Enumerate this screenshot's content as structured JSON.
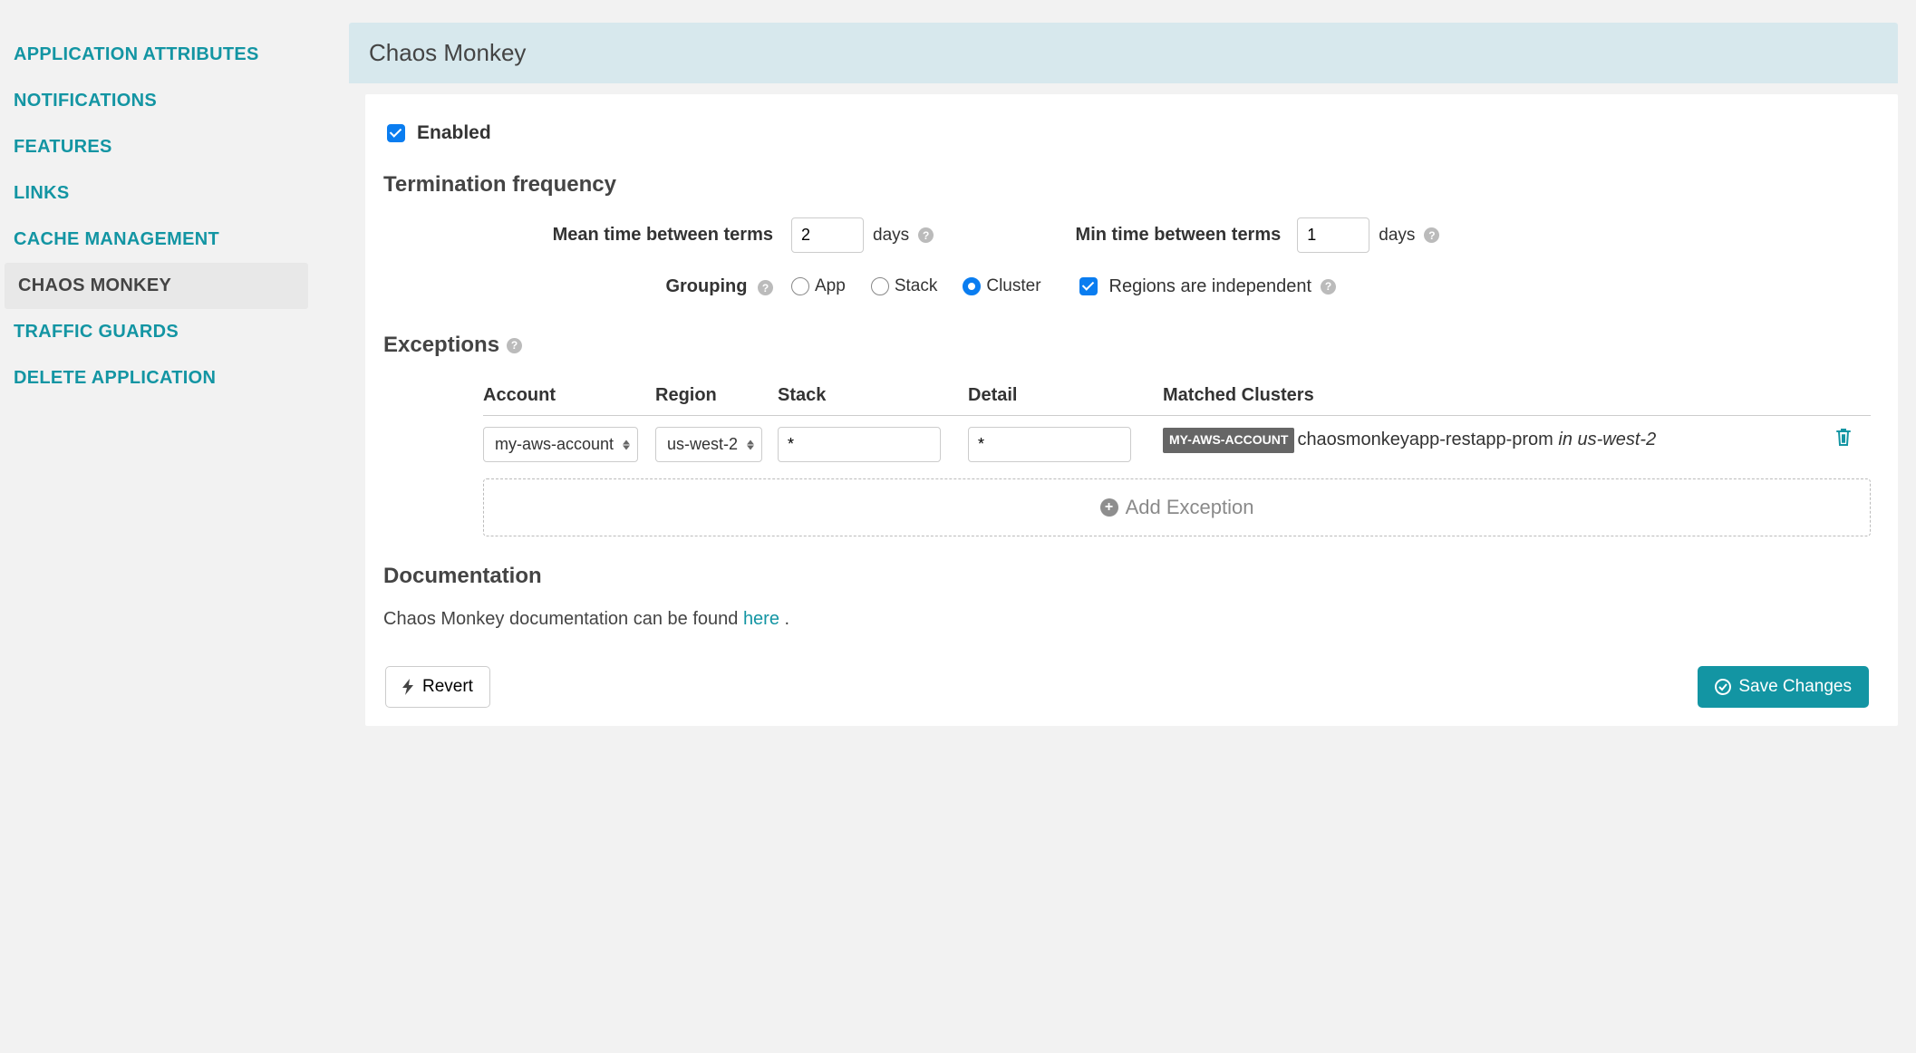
{
  "sidebar": {
    "items": [
      {
        "label": "APPLICATION ATTRIBUTES",
        "active": false
      },
      {
        "label": "NOTIFICATIONS",
        "active": false
      },
      {
        "label": "FEATURES",
        "active": false
      },
      {
        "label": "LINKS",
        "active": false
      },
      {
        "label": "CACHE MANAGEMENT",
        "active": false
      },
      {
        "label": "CHAOS MONKEY",
        "active": true
      },
      {
        "label": "TRAFFIC GUARDS",
        "active": false
      },
      {
        "label": "DELETE APPLICATION",
        "active": false
      }
    ]
  },
  "panel": {
    "title": "Chaos Monkey",
    "enabled_label": "Enabled",
    "enabled": true,
    "termination": {
      "heading": "Termination frequency",
      "mean_label": "Mean time between terms",
      "mean_value": "2",
      "mean_unit": "days",
      "min_label": "Min time between terms",
      "min_value": "1",
      "min_unit": "days",
      "grouping_label": "Grouping",
      "grouping_options": [
        "App",
        "Stack",
        "Cluster"
      ],
      "grouping_selected": "Cluster",
      "regions_independent_label": "Regions are independent",
      "regions_independent": true
    },
    "exceptions": {
      "heading": "Exceptions",
      "cols": {
        "account": "Account",
        "region": "Region",
        "stack": "Stack",
        "detail": "Detail",
        "matched": "Matched Clusters"
      },
      "rows": [
        {
          "account": "my-aws-account",
          "region": "us-west-2",
          "stack": "*",
          "detail": "*",
          "matched": {
            "account_badge": "MY-AWS-ACCOUNT",
            "cluster": "chaosmonkeyapp-restapp-prom",
            "in": "in",
            "region": "us-west-2"
          }
        }
      ],
      "add_label": "Add Exception"
    },
    "documentation": {
      "heading": "Documentation",
      "text_pre": "Chaos Monkey documentation can be found ",
      "link_text": "here",
      "text_post": " ."
    },
    "actions": {
      "revert": "Revert",
      "save": "Save Changes"
    }
  }
}
